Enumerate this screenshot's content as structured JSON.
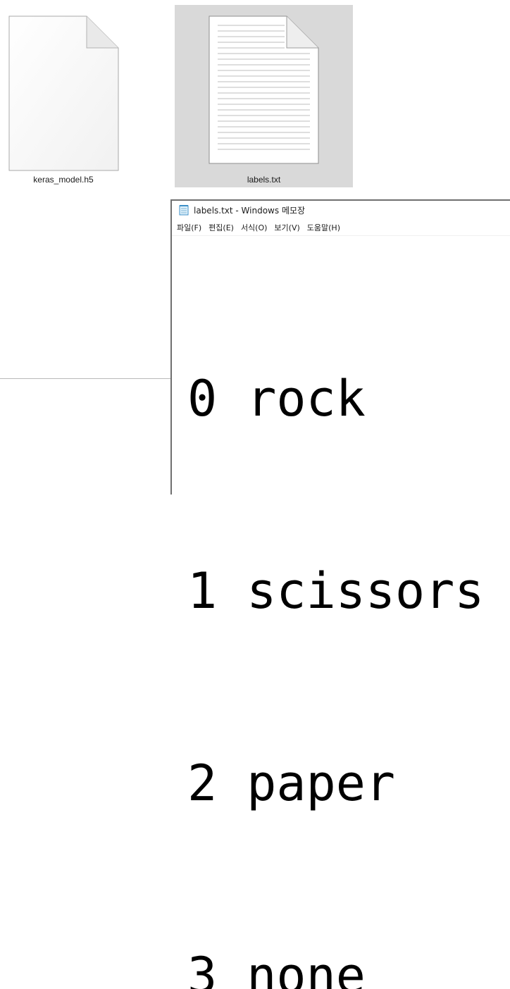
{
  "explorer": {
    "files": [
      {
        "name": "keras_model.h5",
        "icon": "blank-file-icon",
        "selected": false
      },
      {
        "name": "labels.txt",
        "icon": "text-file-icon",
        "selected": true
      }
    ]
  },
  "notepad": {
    "title": "labels.txt - Windows 메모장",
    "icon": "notepad-icon",
    "menu": [
      {
        "label": "파일(F)"
      },
      {
        "label": "편집(E)"
      },
      {
        "label": "서식(O)"
      },
      {
        "label": "보기(V)"
      },
      {
        "label": "도움말(H)"
      }
    ],
    "lines": [
      "0 rock",
      "1 scissors",
      "2 paper",
      "3 none"
    ]
  },
  "colors": {
    "selection": "#d9d9d9",
    "window_border": "#6f6f6f",
    "text": "#000000"
  }
}
